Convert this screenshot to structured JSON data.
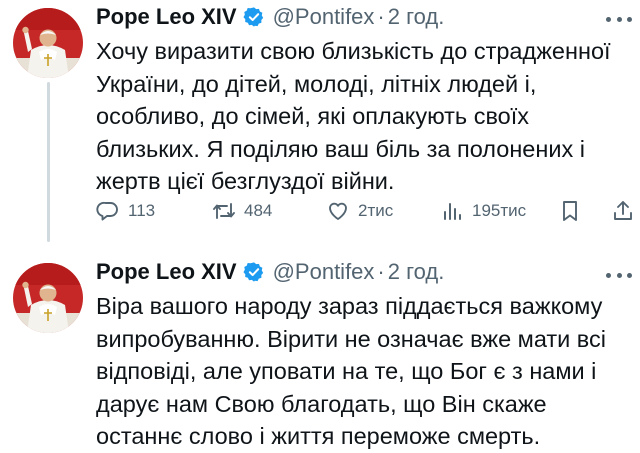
{
  "tweets": [
    {
      "author_name": "Pope Leo XIV",
      "handle": "@Pontifex",
      "separator": "·",
      "time": "2 год.",
      "text": "Хочу виразити свою близькість до страдженної\nУкраїни, до дітей, молоді, літніх людей і,\nособливо, до сімей, які оплакують своїх\nблизьких. Я поділяю ваш біль за полонених і\nжертв цієї безглуздої війни.",
      "actions": {
        "replies": "113",
        "reposts": "484",
        "likes": "2тис",
        "views": "195тис"
      }
    },
    {
      "author_name": "Pope Leo XIV",
      "handle": "@Pontifex",
      "separator": "·",
      "time": "2 год.",
      "text": "Віра вашого народу зараз піддається важкому\nвипробуванню. Вірити не означає вже мати всі\nвідповіді, але уповати на те, що Бог є з нами і\nдарує нам Свою благодать, що Він скаже\nостаннє слово і життя переможе смерть."
    }
  ],
  "icons": {
    "verified": "verified-badge-icon",
    "reply": "reply-icon",
    "repost": "repost-icon",
    "like": "heart-icon",
    "views": "views-chart-icon",
    "bookmark": "bookmark-icon",
    "share": "share-icon",
    "more": "more-dots-icon"
  },
  "colors": {
    "text": "#0f1419",
    "secondary": "#536471",
    "verified_blue": "#1d9bf0",
    "thread_line": "#cfd9de"
  }
}
